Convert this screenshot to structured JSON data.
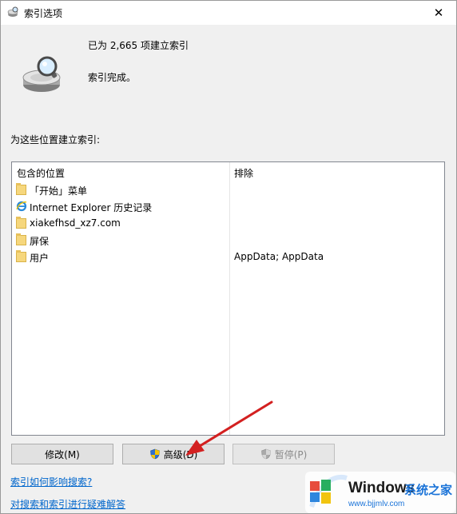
{
  "window": {
    "title": "索引选项",
    "close_glyph": "✕"
  },
  "status": {
    "indexed_count": "已为 2,665 项建立索引",
    "state": "索引完成。"
  },
  "locations": {
    "heading": "为这些位置建立索引:",
    "columns": {
      "included": "包含的位置",
      "excluded": "排除"
    },
    "rows": [
      {
        "location": "「开始」菜单",
        "exclude": "",
        "icon": "folder-icon"
      },
      {
        "location": "Internet Explorer 历史记录",
        "exclude": "",
        "icon": "ie-icon"
      },
      {
        "location": "xiakefhsd_xz7.com",
        "exclude": "",
        "icon": "folder-icon"
      },
      {
        "location": "屏保",
        "exclude": "",
        "icon": "folder-icon"
      },
      {
        "location": "用户",
        "exclude": "AppData; AppData",
        "icon": "folder-icon"
      }
    ]
  },
  "buttons": {
    "modify": "修改(M)",
    "advanced": "高级(D)",
    "pause": "暂停(P)"
  },
  "links": {
    "how_affects": "索引如何影响搜索?",
    "troubleshoot": "对搜索和索引进行疑难解答"
  },
  "watermark": {
    "brand": "Windows",
    "site": "系统之家",
    "url": "www.bjjmlv.com"
  },
  "colors": {
    "link": "#0066cc",
    "annotation_arrow": "#d32020",
    "folder": "#f6d77d"
  }
}
